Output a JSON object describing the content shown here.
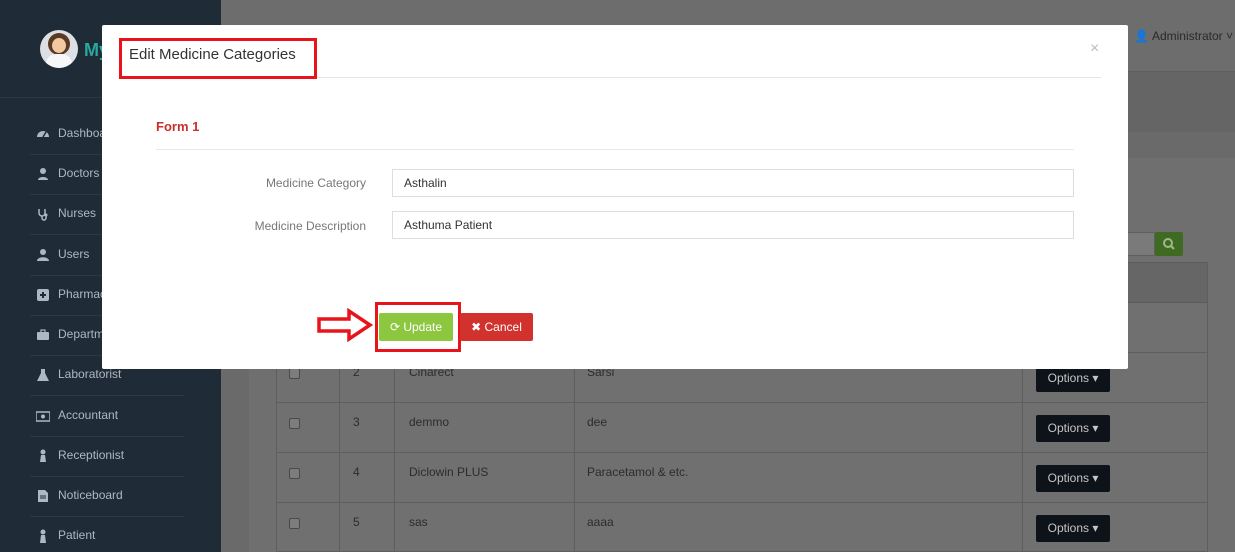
{
  "sidebar": {
    "brand_text": "My",
    "items": [
      {
        "label": "Dashboard",
        "icon": "dashboard-icon"
      },
      {
        "label": "Doctors",
        "icon": "user-md-icon"
      },
      {
        "label": "Nurses",
        "icon": "stethoscope-icon"
      },
      {
        "label": "Users",
        "icon": "user-icon"
      },
      {
        "label": "Pharmacist",
        "icon": "plus-square-icon"
      },
      {
        "label": "Department",
        "icon": "briefcase-icon"
      },
      {
        "label": "Laboratorist",
        "icon": "flask-icon"
      },
      {
        "label": "Accountant",
        "icon": "money-icon"
      },
      {
        "label": "Receptionist",
        "icon": "user-female-icon"
      },
      {
        "label": "Noticeboard",
        "icon": "file-icon"
      },
      {
        "label": "Patient",
        "icon": "user-patient-icon"
      }
    ]
  },
  "topbar": {
    "user": "Administrator"
  },
  "table": {
    "rows": [
      {
        "num": "2",
        "name": "Cinarect",
        "description": "Sarsi",
        "action": "Options"
      },
      {
        "num": "3",
        "name": "demmo",
        "description": "dee",
        "action": "Options"
      },
      {
        "num": "4",
        "name": "Diclowin PLUS",
        "description": "Paracetamol & etc.",
        "action": "Options"
      },
      {
        "num": "5",
        "name": "sas",
        "description": "aaaa",
        "action": "Options"
      }
    ]
  },
  "modal": {
    "title": "Edit Medicine Categories",
    "close": "×",
    "form_heading": "Form 1",
    "fields": {
      "category_label": "Medicine Category",
      "category_value": "Asthalin",
      "description_label": "Medicine Description",
      "description_value": "Asthuma Patient"
    },
    "update_label": "Update",
    "cancel_label": "Cancel"
  },
  "colors": {
    "sidebar_bg": "#1f2b36",
    "update_green": "#8dc63f",
    "cancel_red": "#d2322d",
    "highlight_red": "#e8141b",
    "form_heading_red": "#c9302c"
  }
}
